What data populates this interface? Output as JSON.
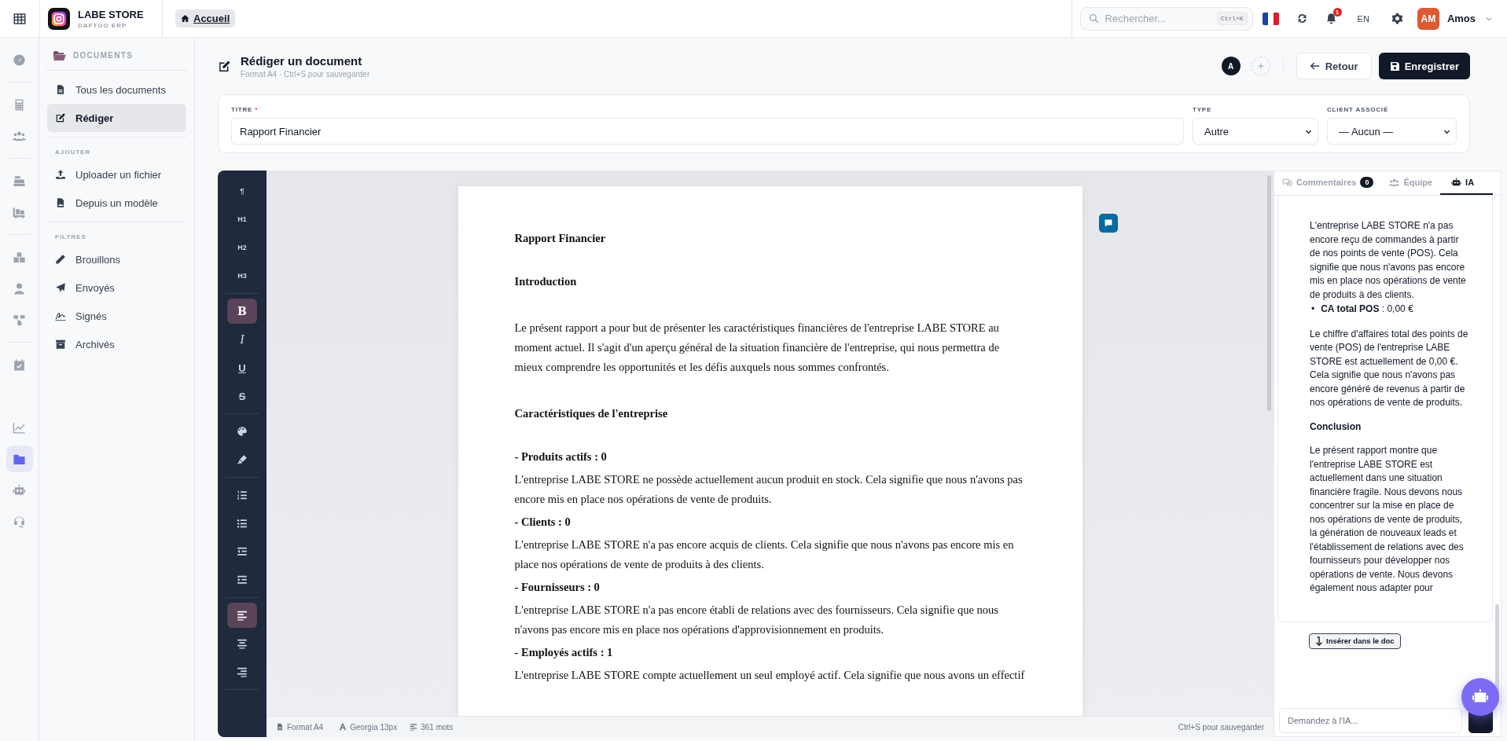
{
  "topbar": {
    "app_name": "LABE STORE",
    "app_subtitle": "DAFTOO ERP",
    "breadcrumb": "Accueil",
    "search": {
      "placeholder": "Rechercher...",
      "shortcut": "Ctrl+K"
    },
    "notifications": "1",
    "language": "EN",
    "user": {
      "initials": "AM",
      "name": "Amos"
    }
  },
  "rail": [
    {
      "kind": "dashboard",
      "selected": false
    },
    {
      "kind": "calculator",
      "selected": false
    },
    {
      "kind": "users",
      "selected": false
    },
    {
      "kind": "register",
      "selected": false
    },
    {
      "kind": "dolly",
      "selected": false
    },
    {
      "kind": "boxes",
      "selected": false
    },
    {
      "kind": "person",
      "selected": false
    },
    {
      "kind": "sitemap",
      "selected": false
    },
    {
      "kind": "calendar",
      "selected": false
    },
    {
      "kind": "chart",
      "selected": false
    },
    {
      "kind": "folder",
      "selected": true
    },
    {
      "kind": "robot",
      "selected": false
    },
    {
      "kind": "headset",
      "selected": false
    }
  ],
  "sidebar": {
    "title": "DOCUMENTS",
    "sections": [
      {
        "items": [
          {
            "label": "Tous les documents",
            "selected": false
          },
          {
            "label": "Rédiger",
            "selected": true
          }
        ]
      },
      {
        "heading": "AJOUTER",
        "items": [
          {
            "label": "Uploader un fichier",
            "selected": false
          },
          {
            "label": "Depuis un modèle",
            "selected": false
          }
        ]
      },
      {
        "heading": "FILTRES",
        "items": [
          {
            "label": "Brouillons",
            "selected": false
          },
          {
            "label": "Envoyés",
            "selected": false
          },
          {
            "label": "Signés",
            "selected": false
          },
          {
            "label": "Archivés",
            "selected": false
          }
        ]
      }
    ]
  },
  "header": {
    "title": "Rédiger un document",
    "subtitle": "Format A4 · Ctrl+S pour sauvegarder",
    "collaborator": "A",
    "back": "Retour",
    "save": "Enregistrer"
  },
  "form": {
    "title": {
      "label": "TITRE",
      "required_mark": "*",
      "value": "Rapport Financier"
    },
    "type": {
      "label": "TYPE",
      "value": "Autre"
    },
    "client": {
      "label": "CLIENT ASSOCIÉ",
      "value": "— Aucun —"
    }
  },
  "toolbar": {
    "groups": [
      {
        "buttons": [
          {
            "kind": "text",
            "label": "¶",
            "selected": false
          },
          {
            "kind": "text",
            "label": "H1",
            "selected": false
          },
          {
            "kind": "text",
            "label": "H2",
            "selected": false
          },
          {
            "kind": "text",
            "label": "H3",
            "selected": false
          }
        ]
      },
      {
        "buttons": [
          {
            "kind": "bold",
            "label": "B",
            "selected": true
          },
          {
            "kind": "italic",
            "label": "I",
            "selected": false
          },
          {
            "kind": "underline",
            "label": "U",
            "selected": false
          },
          {
            "kind": "strike",
            "label": "S",
            "selected": false
          }
        ]
      },
      {
        "buttons": [
          {
            "kind": "palette",
            "selected": false
          },
          {
            "kind": "highlighter",
            "selected": false
          }
        ]
      },
      {
        "buttons": [
          {
            "kind": "ordered-list",
            "selected": false
          },
          {
            "kind": "bullet-list",
            "selected": false
          },
          {
            "kind": "outdent",
            "selected": false
          },
          {
            "kind": "indent",
            "selected": false
          }
        ]
      },
      {
        "buttons": [
          {
            "kind": "align-left",
            "selected": true
          },
          {
            "kind": "align-center",
            "selected": false
          },
          {
            "kind": "align-right",
            "selected": false
          }
        ]
      }
    ]
  },
  "document": {
    "blocks": [
      {
        "kind": "title",
        "text": "Rapport Financier"
      },
      {
        "kind": "heading",
        "text": "Introduction"
      },
      {
        "kind": "paragraph",
        "text": "Le présent rapport a pour but de présenter les caractéristiques financières de l'entreprise LABE STORE au moment actuel. Il s'agit d'un aperçu général de la situation financière de l'entreprise, qui nous permettra de mieux comprendre les opportunités et les défis auxquels nous sommes confrontés."
      },
      {
        "kind": "heading",
        "text": "Caractéristiques de l'entreprise"
      },
      {
        "kind": "item",
        "text": "- Produits actifs : 0"
      },
      {
        "kind": "line",
        "text": "L'entreprise LABE STORE ne possède actuellement aucun produit en stock. Cela signifie que nous n'avons pas encore mis en place nos opérations de vente de produits."
      },
      {
        "kind": "item",
        "text": "- Clients : 0"
      },
      {
        "kind": "line",
        "text": "L'entreprise LABE STORE n'a pas encore acquis de clients. Cela signifie que nous n'avons pas encore mis en place nos opérations de vente de produits à des clients."
      },
      {
        "kind": "item",
        "text": "- Fournisseurs : 0"
      },
      {
        "kind": "line",
        "text": "L'entreprise LABE STORE n'a pas encore établi de relations avec des fournisseurs. Cela signifie que nous n'avons pas encore mis en place nos opérations d'approvisionnement en produits."
      },
      {
        "kind": "item",
        "text": "- Employés actifs : 1"
      },
      {
        "kind": "line",
        "text": "L'entreprise LABE STORE compte actuellement un seul employé actif. Cela signifie que nous avons un effectif"
      }
    ]
  },
  "status_bar": {
    "format": "Format A4",
    "font": "Georgia 13px",
    "words": "361 mots",
    "hint": "Ctrl+S pour sauvegarder"
  },
  "panel": {
    "tabs": [
      {
        "label": "Commentaires",
        "badge": "0",
        "selected": false
      },
      {
        "label": "Équipe",
        "selected": false
      },
      {
        "label": "IA",
        "selected": true
      }
    ],
    "blocks": [
      {
        "kind": "paragraph",
        "text": "L'entreprise LABE STORE n'a pas encore reçu de commandes à partir de nos points de vente (POS). Cela signifie que nous n'avons pas encore mis en place nos opérations de vente de produits à des clients."
      },
      {
        "kind": "bullet",
        "marker": "•",
        "text": "**CA total POS** : 0,00 €"
      },
      {
        "kind": "paragraph",
        "text": "Le chiffre d'affaires total des points de vente (POS) de l'entreprise LABE STORE est actuellement de 0,00 €. Cela signifie que nous n'avons pas encore généré de revenus à partir de nos opérations de vente de produits."
      },
      {
        "kind": "heading",
        "text": "Conclusion"
      },
      {
        "kind": "paragraph",
        "text": "Le présent rapport montre que l'entreprise LABE STORE est actuellement dans une situation financière fragile. Nous devons nous concentrer sur la mise en place de nos opérations de vente de produits, la génération de nouveaux leads et l'établissement de relations avec des fournisseurs pour développer nos opérations de vente. Nous devons également nous adapter pour"
      }
    ],
    "insert": "Insérer dans le doc",
    "chat": {
      "placeholder": "Demandez à l'IA..."
    }
  }
}
